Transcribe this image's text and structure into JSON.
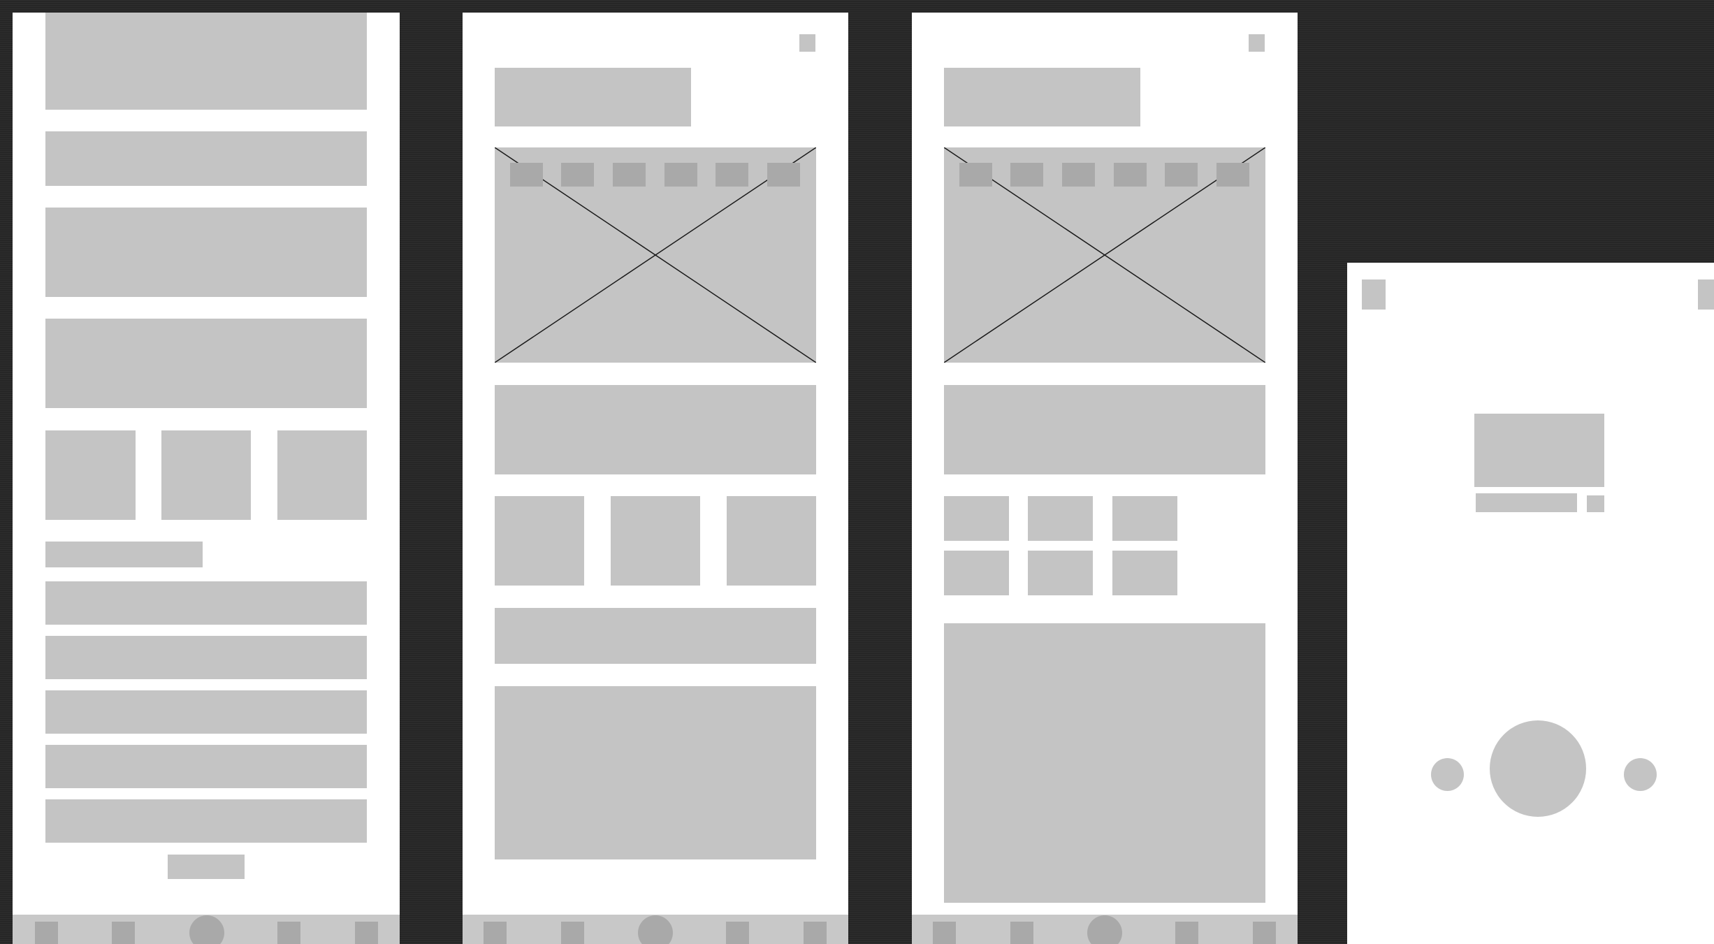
{
  "canvas": {
    "background": "#262626"
  },
  "palette": {
    "screen": "#ffffff",
    "placeholder": "#c4c4c4",
    "placeholder_dark": "#a9a9a9",
    "cross_line": "#1a1a1a"
  },
  "screens": [
    {
      "name": "list-screen",
      "nav_icons": [
        "square",
        "square",
        "circle",
        "square",
        "square"
      ]
    },
    {
      "name": "detail-screen",
      "carousel_dots": 6,
      "nav_icons": [
        "square",
        "square",
        "circle",
        "square",
        "square"
      ]
    },
    {
      "name": "grid-screen",
      "carousel_dots": 6,
      "thumbnail_grid": [
        3,
        2
      ],
      "nav_icons": [
        "square",
        "square",
        "circle",
        "square",
        "square"
      ]
    },
    {
      "name": "player-screen",
      "controls": [
        "circle-small",
        "circle-large",
        "circle-small"
      ]
    }
  ]
}
